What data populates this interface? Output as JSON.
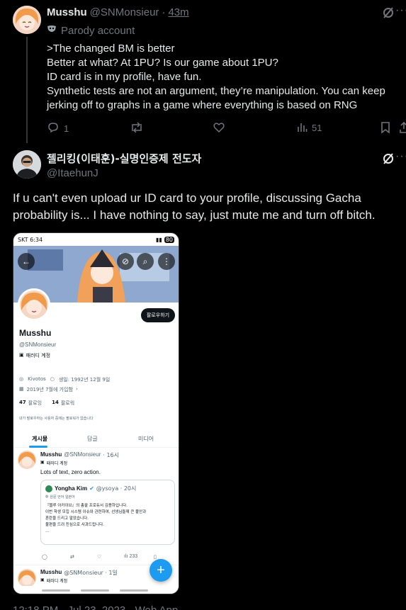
{
  "parent_tweet": {
    "author_name": "Musshu",
    "author_handle": "@SNMonsieur",
    "separator": "·",
    "time": "43m",
    "parody_label": "Parody account",
    "lines": [
      ">The changed BM is better",
      "Better at what? At 1PU? Is our game about 1PU?",
      "ID card is in my profile, have fun.",
      "Synthetic tests are not an argument, they’re manipulation. You can keep",
      "jerking off to graphs in a game where everything is based on RNG"
    ],
    "reply_count": "1",
    "view_count": "51"
  },
  "main_tweet": {
    "author_name": "젤리킹(이태훈)-실명인증제 전도자",
    "author_handle": "@ItaehunJ",
    "text_line1": "If u can't even upload ur ID card to your profile, discussing Gacha",
    "text_line2": "probability is... I have nothing to say, just mute me and turn off bitch.",
    "footer_partial": "12:18 PM · Jul 23, 2023 · Web App"
  },
  "phone": {
    "status_left": "SKT 6:34",
    "status_right": "80",
    "follow_button": "팔로우하기",
    "profile_name": "Musshu",
    "profile_handle": "@SNMonsieur",
    "parody_label": "패러디 계정",
    "location": "Kivotos",
    "birthday": "생일: 1992년 12월 9일",
    "joined": "2019년 7월에 가입함",
    "following_count": "47",
    "following_label": "팔로잉",
    "followers_count": "14",
    "followers_label": "팔로워",
    "followed_by_note": "내가 팔로우하는 사용자 중에는 팔로워가 없습니다",
    "tabs": [
      "게시물",
      "답글",
      "미디어"
    ],
    "post1": {
      "name": "Musshu",
      "handle": "@SNMonsieur",
      "time": "· 16시",
      "parody": "패러디 계정",
      "text": "Lots of text, zero action."
    },
    "quote": {
      "name": "Yongha Kim",
      "handle": "@ysoya · 20시",
      "translate": "원문 언어 일본어",
      "lines": [
        "『블루 아카이브』의 총괄 프로듀서 김용하입니다.",
        "이번 학생 모집 시스템 이슈와 관련하여, 선생님들께 큰 불안과",
        "혼란을 드리고 말았습니다.",
        "불편을 드려 진심으로 사과드립니다.",
        "..."
      ]
    },
    "post1_views": "233",
    "post2": {
      "name": "Musshu",
      "handle": "@SNMonsieur · 1일",
      "parody": "패러디 계정"
    }
  },
  "colors": {
    "background": "#000000",
    "text": "#e7e9ea",
    "muted": "#71767b",
    "accent": "#1d9bf0"
  }
}
